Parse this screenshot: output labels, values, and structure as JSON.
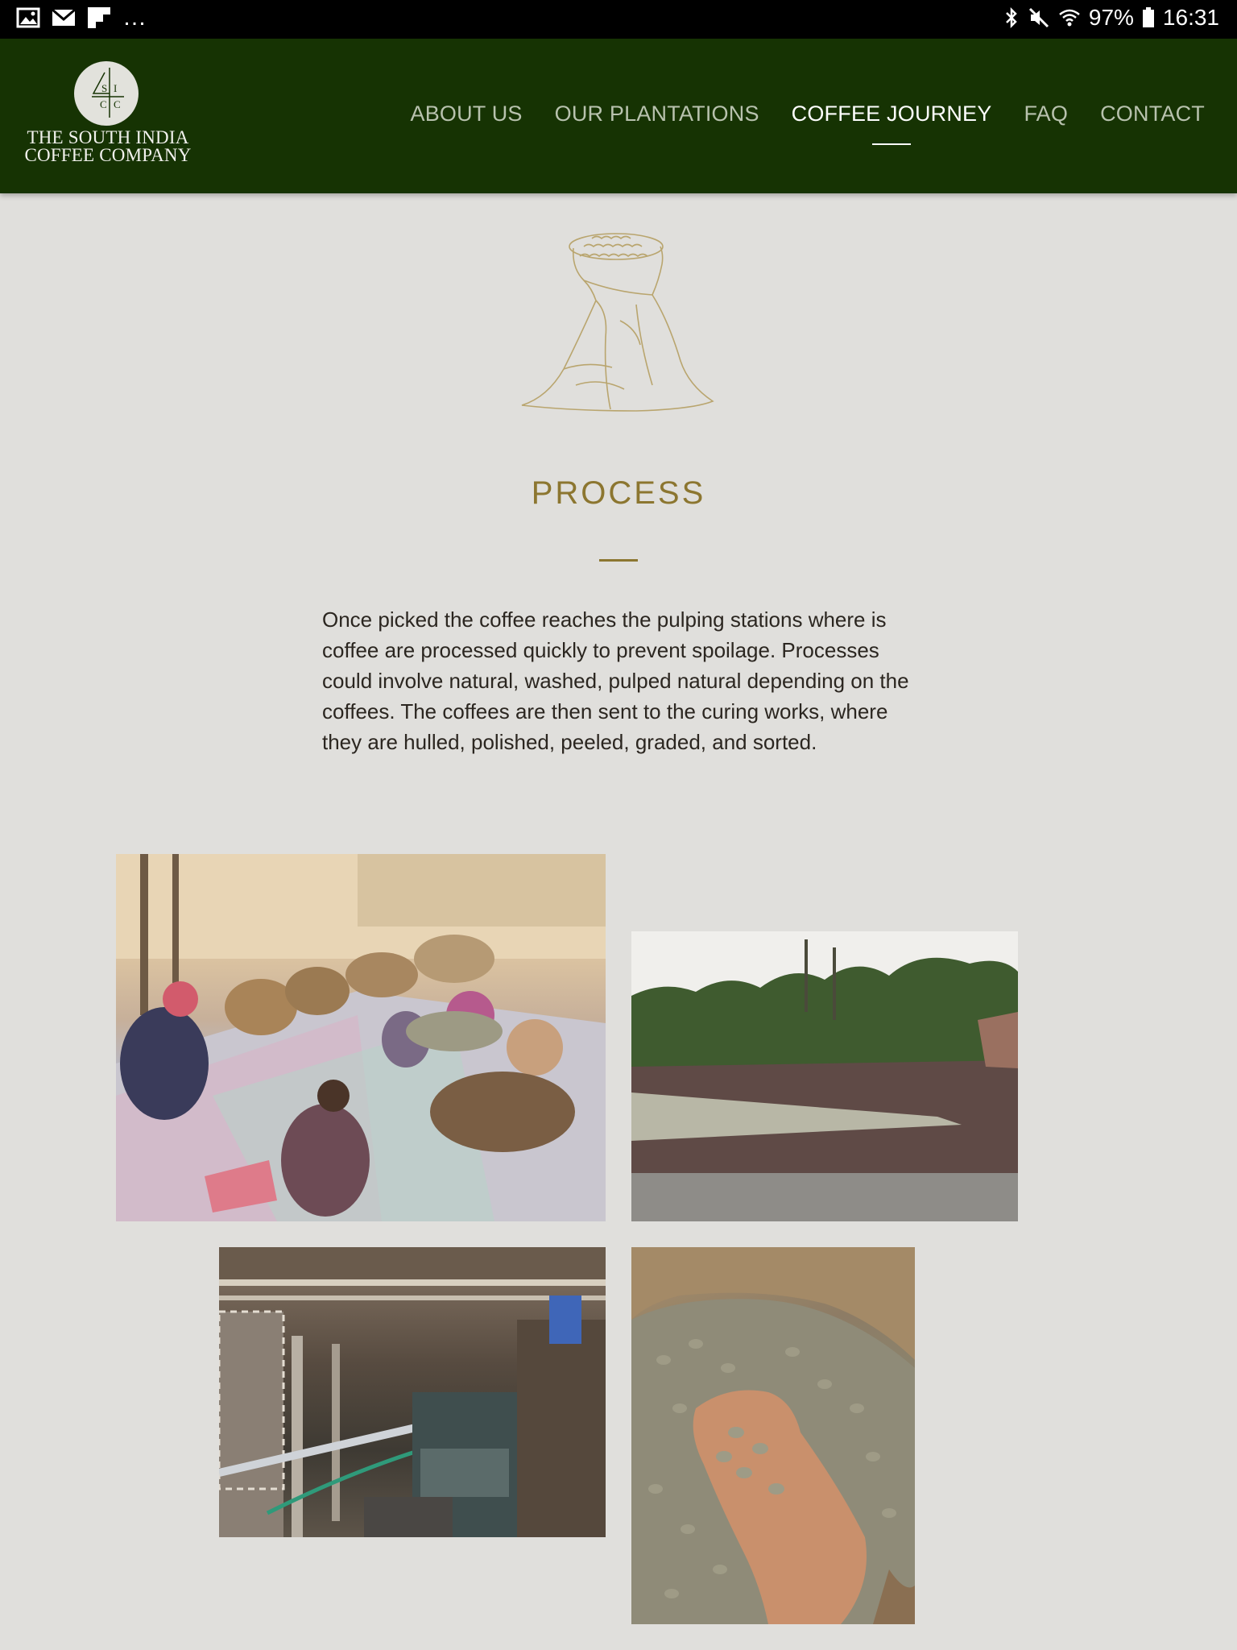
{
  "status_bar": {
    "left_icons": [
      "image-icon",
      "mail-icon",
      "flipboard-icon"
    ],
    "overflow": "…",
    "right_icons": [
      "bluetooth-icon",
      "mute-icon",
      "wifi-icon"
    ],
    "battery": "97%",
    "time": "16:31"
  },
  "header": {
    "logo": {
      "monogram": "4 S I C C",
      "line1": "THE SOUTH INDIA",
      "line2": "COFFEE COMPANY"
    },
    "nav": [
      {
        "label": "ABOUT US",
        "active": false
      },
      {
        "label": "OUR PLANTATIONS",
        "active": false
      },
      {
        "label": "COFFEE JOURNEY",
        "active": true
      },
      {
        "label": "FAQ",
        "active": false
      },
      {
        "label": "CONTACT",
        "active": false
      }
    ]
  },
  "section": {
    "icon": "coffee-sack-icon",
    "title": "PROCESS",
    "body": "Once picked the coffee reaches the pulping stations where is coffee are processed quickly to prevent spoilage. Processes could involve natural, washed, pulped natural depending on the coffees. The coffees are then sent to the curing works, where they are hulled, polished, peeled, graded, and sorted."
  },
  "colors": {
    "header_bg": "#163303",
    "page_bg": "#e0dfdc",
    "accent": "#8c7630",
    "nav_inactive": "#b8c2ae",
    "text": "#2b2620"
  },
  "gallery": [
    "sorting-beans-photo",
    "drying-yard-photo",
    "curing-works-machinery-photo",
    "green-beans-in-hand-photo"
  ]
}
